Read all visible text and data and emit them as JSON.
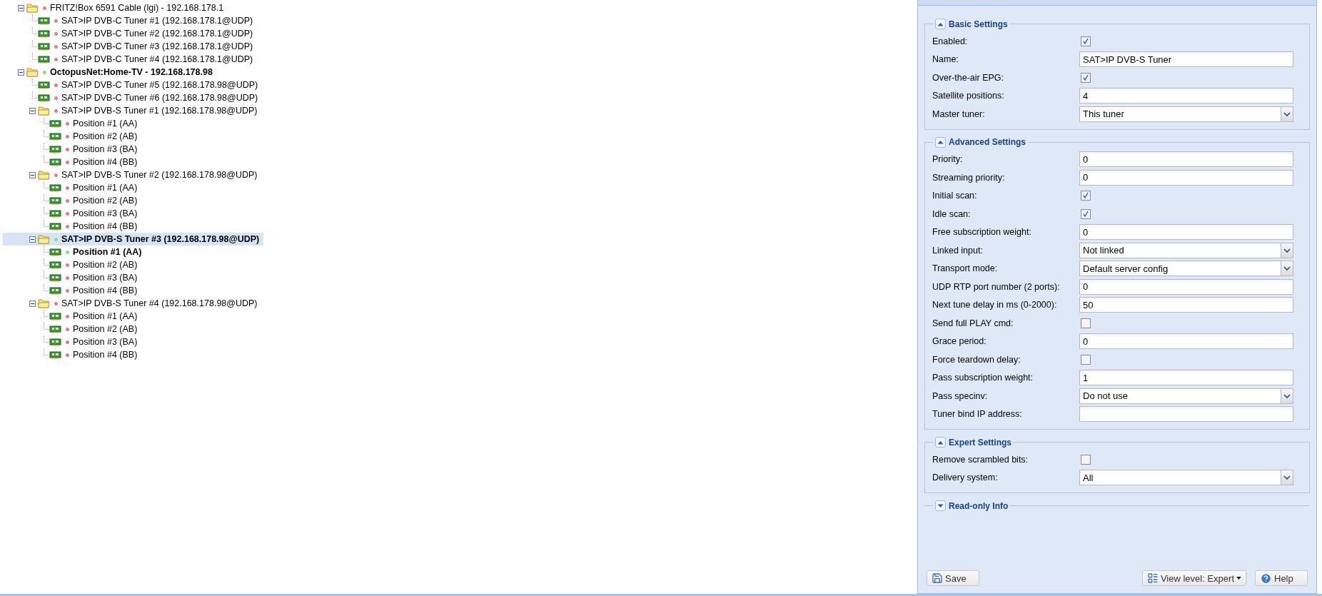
{
  "tree": [
    {
      "kind": "folder",
      "label": "FRITZ!Box 6591 Cable (lgi) - 192.168.178.1",
      "color": "#f07878",
      "active": false,
      "expanded": true,
      "selected": false,
      "children": [
        {
          "kind": "device",
          "label": "SAT>IP DVB-C Tuner #1 (192.168.178.1@UDP)",
          "color": "#f07878",
          "active": false,
          "selected": false
        },
        {
          "kind": "device",
          "label": "SAT>IP DVB-C Tuner #2 (192.168.178.1@UDP)",
          "color": "#f07878",
          "active": false,
          "selected": false
        },
        {
          "kind": "device",
          "label": "SAT>IP DVB-C Tuner #3 (192.168.178.1@UDP)",
          "color": "#f07878",
          "active": false,
          "selected": false
        },
        {
          "kind": "device",
          "label": "SAT>IP DVB-C Tuner #4 (192.168.178.1@UDP)",
          "color": "#f07878",
          "active": false,
          "selected": false
        }
      ]
    },
    {
      "kind": "folder",
      "label": "OctopusNet:Home-TV - 192.168.178.98",
      "color": "#88e088",
      "active": true,
      "expanded": true,
      "selected": false,
      "children": [
        {
          "kind": "device",
          "label": "SAT>IP DVB-C Tuner #5 (192.168.178.98@UDP)",
          "color": "#f07878",
          "active": false,
          "selected": false
        },
        {
          "kind": "device",
          "label": "SAT>IP DVB-C Tuner #6 (192.168.178.98@UDP)",
          "color": "#f07878",
          "active": false,
          "selected": false
        },
        {
          "kind": "folder",
          "label": "SAT>IP DVB-S Tuner #1 (192.168.178.98@UDP)",
          "color": "#f07878",
          "active": false,
          "expanded": true,
          "selected": false,
          "children": [
            {
              "kind": "device",
              "label": "Position #1 (AA)",
              "color": "#f07878",
              "active": false,
              "selected": false
            },
            {
              "kind": "device",
              "label": "Position #2 (AB)",
              "color": "#f07878",
              "active": false,
              "selected": false
            },
            {
              "kind": "device",
              "label": "Position #3 (BA)",
              "color": "#f07878",
              "active": false,
              "selected": false
            },
            {
              "kind": "device",
              "label": "Position #4 (BB)",
              "color": "#f07878",
              "active": false,
              "selected": false
            }
          ]
        },
        {
          "kind": "folder",
          "label": "SAT>IP DVB-S Tuner #2 (192.168.178.98@UDP)",
          "color": "#f07878",
          "active": false,
          "expanded": true,
          "selected": false,
          "children": [
            {
              "kind": "device",
              "label": "Position #1 (AA)",
              "color": "#f07878",
              "active": false,
              "selected": false
            },
            {
              "kind": "device",
              "label": "Position #2 (AB)",
              "color": "#f07878",
              "active": false,
              "selected": false
            },
            {
              "kind": "device",
              "label": "Position #3 (BA)",
              "color": "#f07878",
              "active": false,
              "selected": false
            },
            {
              "kind": "device",
              "label": "Position #4 (BB)",
              "color": "#f07878",
              "active": false,
              "selected": false
            }
          ]
        },
        {
          "kind": "folder",
          "label": "SAT>IP DVB-S Tuner #3 (192.168.178.98@UDP)",
          "color": "#88e088",
          "active": true,
          "expanded": true,
          "selected": true,
          "children": [
            {
              "kind": "device",
              "label": "Position #1 (AA)",
              "color": "#88e088",
              "active": true,
              "selected": false
            },
            {
              "kind": "device",
              "label": "Position #2 (AB)",
              "color": "#f07878",
              "active": false,
              "selected": false
            },
            {
              "kind": "device",
              "label": "Position #3 (BA)",
              "color": "#f07878",
              "active": false,
              "selected": false
            },
            {
              "kind": "device",
              "label": "Position #4 (BB)",
              "color": "#f07878",
              "active": false,
              "selected": false
            }
          ]
        },
        {
          "kind": "folder",
          "label": "SAT>IP DVB-S Tuner #4 (192.168.178.98@UDP)",
          "color": "#f07878",
          "active": false,
          "expanded": true,
          "selected": false,
          "children": [
            {
              "kind": "device",
              "label": "Position #1 (AA)",
              "color": "#f07878",
              "active": false,
              "selected": false
            },
            {
              "kind": "device",
              "label": "Position #2 (AB)",
              "color": "#f07878",
              "active": false,
              "selected": false
            },
            {
              "kind": "device",
              "label": "Position #3 (BA)",
              "color": "#f07878",
              "active": false,
              "selected": false
            },
            {
              "kind": "device",
              "label": "Position #4 (BB)",
              "color": "#f07878",
              "active": false,
              "selected": false
            }
          ]
        }
      ]
    }
  ],
  "panel": {
    "sections": [
      {
        "title": "Basic Settings",
        "expanded": true,
        "fields": [
          {
            "kind": "checkbox",
            "label": "Enabled:",
            "checked": true
          },
          {
            "kind": "text",
            "label": "Name:",
            "value": "SAT>IP DVB-S Tuner"
          },
          {
            "kind": "checkbox",
            "label": "Over-the-air EPG:",
            "checked": true
          },
          {
            "kind": "text",
            "label": "Satellite positions:",
            "value": "4"
          },
          {
            "kind": "select",
            "label": "Master tuner:",
            "value": "This tuner"
          }
        ]
      },
      {
        "title": "Advanced Settings",
        "expanded": true,
        "fields": [
          {
            "kind": "text",
            "label": "Priority:",
            "value": "0"
          },
          {
            "kind": "text",
            "label": "Streaming priority:",
            "value": "0"
          },
          {
            "kind": "checkbox",
            "label": "Initial scan:",
            "checked": true
          },
          {
            "kind": "checkbox",
            "label": "Idle scan:",
            "checked": true
          },
          {
            "kind": "text",
            "label": "Free subscription weight:",
            "value": "0"
          },
          {
            "kind": "select",
            "label": "Linked input:",
            "value": "Not linked"
          },
          {
            "kind": "select",
            "label": "Transport mode:",
            "value": "Default server config"
          },
          {
            "kind": "text",
            "label": "UDP RTP port number (2 ports):",
            "value": "0"
          },
          {
            "kind": "text",
            "label": "Next tune delay in ms (0-2000):",
            "value": "50"
          },
          {
            "kind": "checkbox",
            "label": "Send full PLAY cmd:",
            "checked": false
          },
          {
            "kind": "text",
            "label": "Grace period:",
            "value": "0"
          },
          {
            "kind": "checkbox",
            "label": "Force teardown delay:",
            "checked": false
          },
          {
            "kind": "text",
            "label": "Pass subscription weight:",
            "value": "1"
          },
          {
            "kind": "select",
            "label": "Pass specinv:",
            "value": "Do not use"
          },
          {
            "kind": "text",
            "label": "Tuner bind IP address:"
          }
        ]
      },
      {
        "title": "Expert Settings",
        "expanded": true,
        "fields": [
          {
            "kind": "checkbox",
            "label": "Remove scrambled bits:",
            "checked": false
          },
          {
            "kind": "select",
            "label": "Delivery system:",
            "value": "All"
          }
        ]
      },
      {
        "title": "Read-only Info",
        "expanded": false
      }
    ],
    "buttons": [
      {
        "kind": "save",
        "label": "Save"
      },
      {
        "kind": "menu",
        "label": "View level: Expert"
      },
      {
        "kind": "help",
        "label": "Help"
      }
    ]
  }
}
